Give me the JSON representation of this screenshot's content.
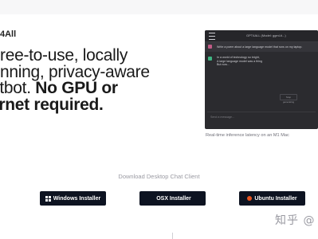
{
  "brand": {
    "name": "4All"
  },
  "hero": {
    "line1": "ree-to-use, locally",
    "line2": "nning, privacy-aware",
    "line3_plain": "atbot. ",
    "line3_bold": "No GPU or",
    "line4_bold": "ernet required."
  },
  "demo": {
    "title": "GPT4ALL (Model: ggml-ti...)",
    "prompt": "Write a poem about a large language model that runs on my laptop.",
    "response_lines": [
      "In a world of technology so bright,",
      "A large language model was a thing",
      "But now..."
    ],
    "stop_label": "Stop generating",
    "input_placeholder": "Send a message...",
    "caption": "Real-time inference latency on an M1 Mac"
  },
  "download": {
    "title": "Download Desktop Chat Client",
    "buttons": [
      {
        "label": "Windows Installer",
        "icon": "windows-icon"
      },
      {
        "label": "OSX Installer",
        "icon": "apple-icon"
      },
      {
        "label": "Ubuntu Installer",
        "icon": "ubuntu-icon"
      }
    ]
  },
  "watermark": {
    "text": "知乎 @"
  },
  "colors": {
    "button_bg": "#0d1321",
    "demo_bg": "#2b2b2f",
    "ubuntu_orange": "#e95420"
  }
}
